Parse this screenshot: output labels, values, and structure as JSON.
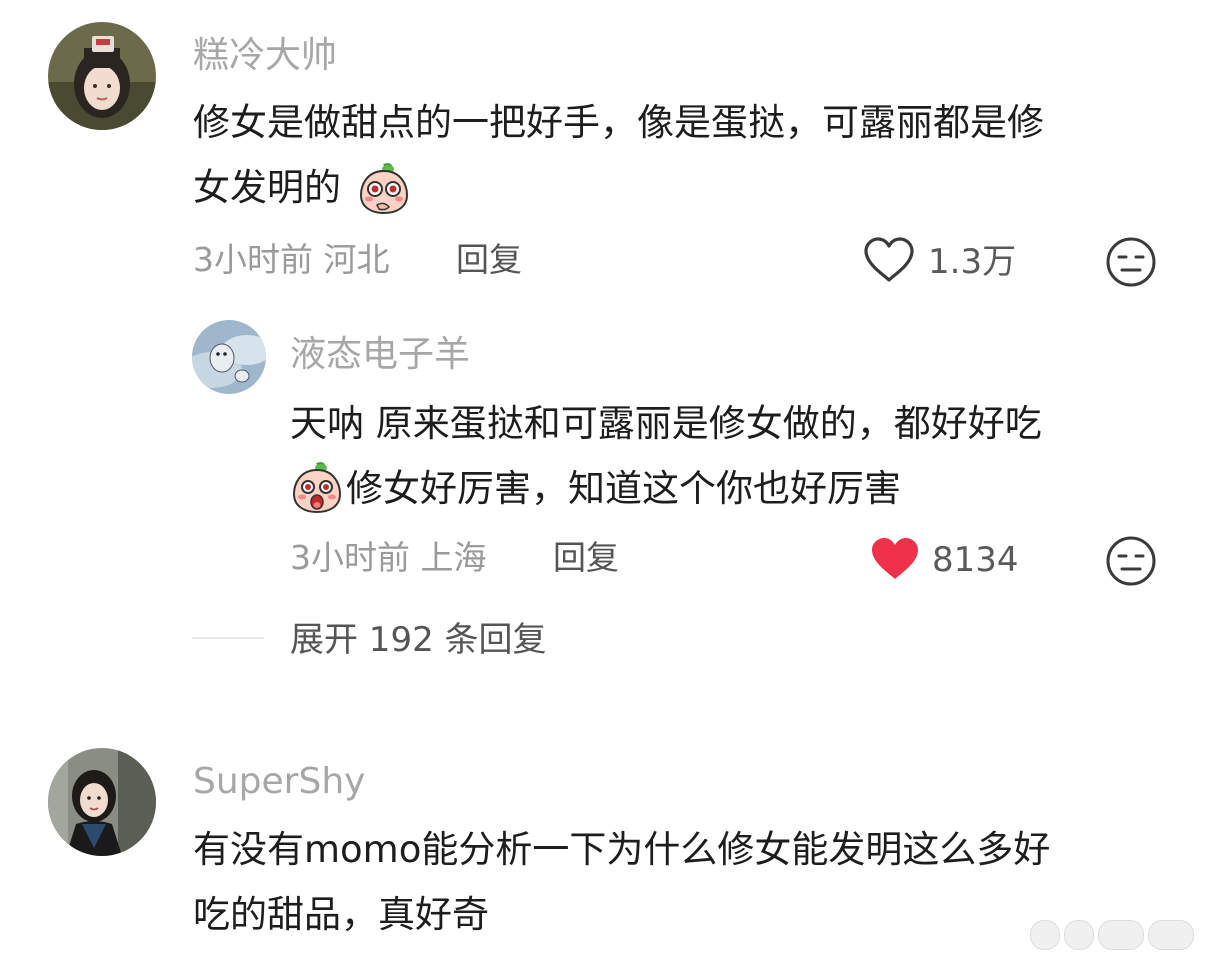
{
  "colors": {
    "username": "#a7a7a7",
    "body_text": "#1d1d1d",
    "meta": "#9a9a9a",
    "liked_heart": "#f0314b",
    "icon_stroke": "#3a3a3a"
  },
  "comments": [
    {
      "username": "糕冷大帅",
      "text_lines": [
        "修女是做甜点的一把好手，像是蛋挞，可露丽都是修",
        "女发明的"
      ],
      "emoji": "shy-peach-emoji",
      "meta": "3小时前 河北",
      "reply_label": "回复",
      "like_count": "1.3万",
      "liked": false,
      "replies": [
        {
          "username": "液态电子羊",
          "text_lines": [
            "天呐 原来蛋挞和可露丽是修女做的，都好好吃",
            "修女好厉害，知道这个你也好厉害"
          ],
          "emoji": "surprised-peach-emoji",
          "meta": "3小时前 上海",
          "reply_label": "回复",
          "like_count": "8134",
          "liked": true
        }
      ],
      "expand_label": "展开 192 条回复"
    },
    {
      "username": "SuperShy",
      "text_lines": [
        "有没有momo能分析一下为什么修女能发明这么多好",
        "吃的甜品，真好奇"
      ]
    }
  ]
}
